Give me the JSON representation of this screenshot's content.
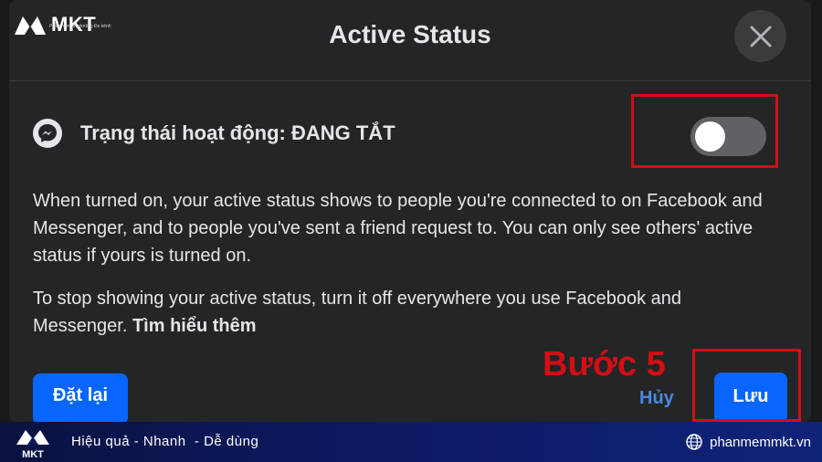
{
  "brand": {
    "logo_text": "MKT",
    "logo_subtext": "Phần mềm Marketing Đa kênh"
  },
  "dialog": {
    "title": "Active Status",
    "status_label": "Trạng thái hoạt động: ĐANG TẮT",
    "toggle_on": false,
    "description_1": "When turned on, your active status shows to people you're connected to on Facebook and Messenger, and to people you've sent a friend request to. You can only see others' active status if yours is turned on.",
    "description_2": "To stop showing your active status, turn it off everywhere you use Facebook and Messenger.",
    "learn_more": "Tìm hiểu thêm",
    "reset_label": "Đặt lại",
    "cancel_label": "Hủy",
    "save_label": "Lưu"
  },
  "annotation": {
    "step_label": "Bước 5",
    "highlight_color": "#d20f14"
  },
  "footer": {
    "tagline": "Hiệu quả - Nhanh  - Dễ dùng",
    "website": "phanmemmkt.vn"
  },
  "colors": {
    "dialog_bg": "#242526",
    "primary_button": "#0866ff",
    "link": "#4b88e0"
  }
}
